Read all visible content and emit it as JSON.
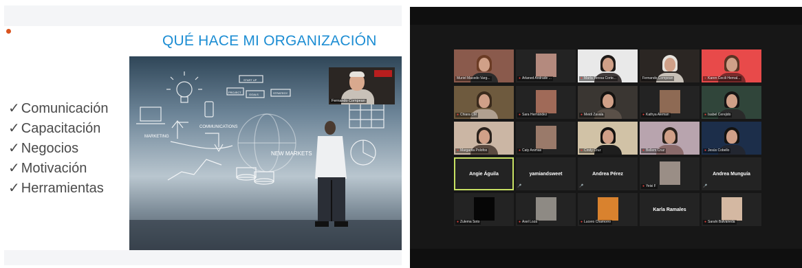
{
  "slide": {
    "title": "QUÉ HACE MI ORGANIZACIÓN",
    "check_mark": "✓",
    "bullets": [
      "Comunicación",
      "Capacitación",
      "Negocios",
      "Motivación",
      "Herramientas"
    ],
    "image_labels": [
      "MARKETING",
      "COMMUNICATIONS",
      "NEW MARKETS",
      "START UP",
      "GOALS",
      "PROJECT",
      "STRATEGY"
    ],
    "presenter_name": "Fernando Compean",
    "accent_color": "#1c8dd3"
  },
  "gallery": {
    "mic_icon": "mic-muted-icon",
    "rows": [
      [
        {
          "name": "Muriel Macedo Varg...",
          "type": "video",
          "bg": "#8a5a4c",
          "hair": "#6b3b24",
          "body": "#2b2b2b",
          "muted": false
        },
        {
          "name": "Arlaned Andrade ...",
          "type": "thumb",
          "bg": "#232323",
          "thumb": "#b48a7e",
          "muted": true
        },
        {
          "name": "María Teresa Corte...",
          "type": "video",
          "bg": "#e9e9e9",
          "hair": "#1e1a18",
          "body": "#403a3a",
          "muted": true
        },
        {
          "name": "Fernando Compean",
          "type": "video",
          "bg": "#2b2623",
          "hair": "#e6e2dc",
          "body": "#c8c1b8",
          "muted": false
        },
        {
          "name": "Karen Cecili Hernal...",
          "type": "video",
          "bg": "#e84a4a",
          "hair": "#5a3424",
          "body": "#7a2a2a",
          "muted": true
        }
      ],
      [
        {
          "name": "Chiara CM",
          "type": "video",
          "bg": "#6e5a3e",
          "hair": "#3a2a1c",
          "body": "#b0a090",
          "muted": true
        },
        {
          "name": "Sara Hernández",
          "type": "thumb",
          "bg": "#232323",
          "thumb": "#a06a58",
          "muted": true
        },
        {
          "name": "Meidi Zavala",
          "type": "video",
          "bg": "#3a3632",
          "hair": "#141210",
          "body": "#5a5048",
          "muted": true
        },
        {
          "name": "Kathya Aleman",
          "type": "thumb",
          "bg": "#232323",
          "thumb": "#8e6a54",
          "muted": true
        },
        {
          "name": "Isabel Cerejido",
          "type": "video",
          "bg": "#30453a",
          "hair": "#161414",
          "body": "#2a2a2a",
          "muted": true
        }
      ],
      [
        {
          "name": "Margarita Polofox",
          "type": "video",
          "bg": "#cbb6a4",
          "hair": "#2a221c",
          "body": "#5a4a40",
          "muted": true
        },
        {
          "name": "Caty Animas",
          "type": "thumb",
          "bg": "#232323",
          "thumb": "#9a7a6a",
          "muted": true
        },
        {
          "name": "Cindy Cruz",
          "type": "video",
          "bg": "#d1c2a6",
          "hair": "#141210",
          "body": "#1e1e1e",
          "muted": true
        },
        {
          "name": "Bellem Cruz",
          "type": "video",
          "bg": "#b8a4ae",
          "hair": "#2a221c",
          "body": "#8a6a6a",
          "muted": true
        },
        {
          "name": "Jesús Cobello",
          "type": "video",
          "bg": "#1c2e4a",
          "hair": "#141210",
          "body": "#222630",
          "muted": true
        }
      ],
      [
        {
          "name": "Angie Águila",
          "type": "name",
          "muted": false,
          "active": true
        },
        {
          "name": "yamiandsweet",
          "type": "name",
          "muted": true
        },
        {
          "name": "Andrea Pérez",
          "type": "name",
          "muted": true
        },
        {
          "name": "Yeisi F",
          "type": "thumb",
          "bg": "#232323",
          "thumb": "#9a8e86",
          "muted": true
        },
        {
          "name": "Andrea Munguía",
          "type": "name",
          "muted": true
        }
      ],
      [
        {
          "name": "Zulema Soto",
          "type": "thumb",
          "bg": "#232323",
          "thumb": "#060606",
          "muted": true
        },
        {
          "name": "Axel Loza",
          "type": "thumb",
          "bg": "#232323",
          "thumb": "#8e8a84",
          "muted": true
        },
        {
          "name": "Lucero Chamorro",
          "type": "thumb",
          "bg": "#232323",
          "thumb": "#d9822e",
          "muted": true
        },
        {
          "name": "Karla Ramales",
          "type": "name",
          "muted": false,
          "plain": true
        },
        {
          "name": "Sarahi Balvaneda",
          "type": "thumb",
          "bg": "#232323",
          "thumb": "#d4b8a2",
          "muted": true
        }
      ]
    ]
  }
}
